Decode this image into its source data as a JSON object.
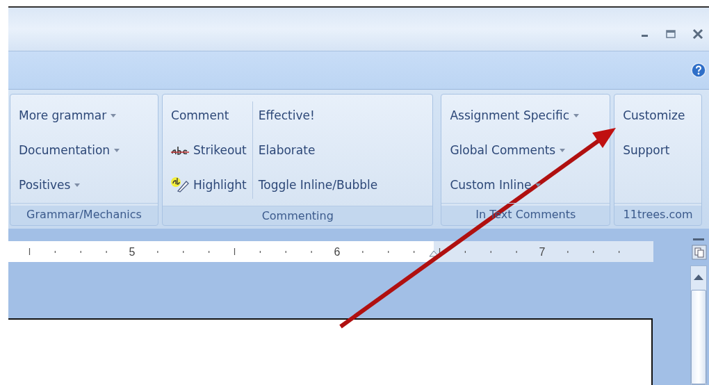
{
  "ribbon": {
    "groups": [
      {
        "label": "Grammar/Mechanics",
        "columns": [
          [
            {
              "label": "More grammar",
              "kind": "dropdown"
            },
            {
              "label": "Documentation",
              "kind": "dropdown"
            },
            {
              "label": "Positives",
              "kind": "dropdown"
            }
          ]
        ]
      },
      {
        "label": "Commenting",
        "columns": [
          [
            {
              "label": "Comment",
              "kind": "plain"
            },
            {
              "label": "Strikeout",
              "kind": "strike"
            },
            {
              "label": "Highlight",
              "kind": "highlight"
            }
          ],
          [
            {
              "label": "Effective!",
              "kind": "plain"
            },
            {
              "label": "Elaborate",
              "kind": "plain"
            },
            {
              "label": "Toggle Inline/Bubble",
              "kind": "plain"
            }
          ]
        ]
      },
      {
        "label": "In Text Comments",
        "columns": [
          [
            {
              "label": "Assignment Specific",
              "kind": "dropdown"
            },
            {
              "label": "Global Comments",
              "kind": "dropdown"
            },
            {
              "label": "Custom Inline",
              "kind": "dropdown"
            }
          ]
        ]
      },
      {
        "label": "11trees.com",
        "columns": [
          [
            {
              "label": "Customize",
              "kind": "plain"
            },
            {
              "label": "Support",
              "kind": "plain"
            }
          ]
        ]
      }
    ]
  },
  "ruler": {
    "numbers": [
      "5",
      "6",
      "7"
    ]
  }
}
